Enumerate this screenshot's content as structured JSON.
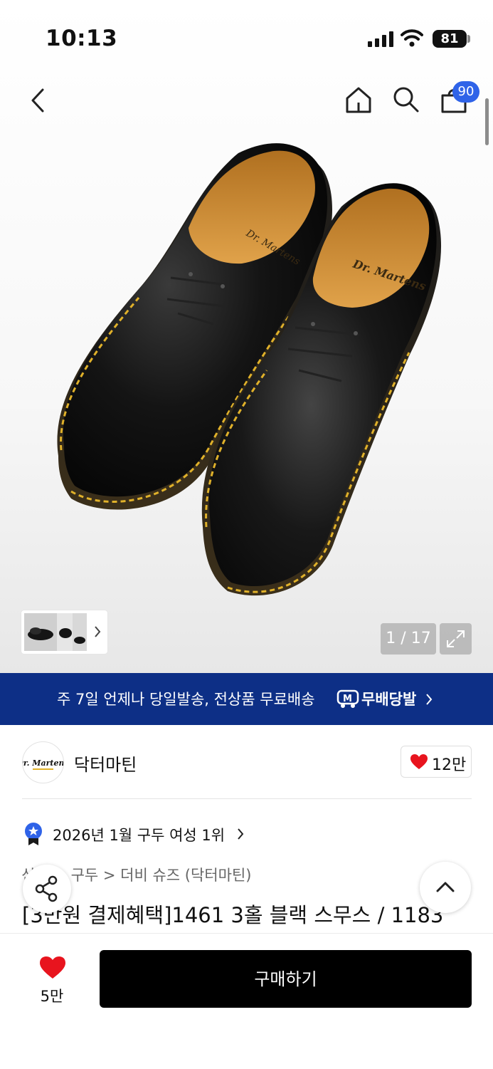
{
  "status_bar": {
    "time": "10:13",
    "battery": "81"
  },
  "header": {
    "cart_badge": "90",
    "icons": [
      "back-arrow-icon",
      "home-icon",
      "search-icon",
      "shopping-bag-icon"
    ]
  },
  "gallery": {
    "counter": "1 / 17",
    "expand_icon": "expand-icon"
  },
  "promo_banner": {
    "text": "주 7일 언제나 당일발송, 전상품 무료배송",
    "logo_text": "무배당발",
    "background": "#0d2f86"
  },
  "brand": {
    "name": "닥터마틴",
    "likes": "12만",
    "logo_text": "Dr. Martens"
  },
  "ranking": {
    "text": "2026년 1월 구두 여성 1위"
  },
  "breadcrumb": {
    "text": "신발 > 구두 > 더비 슈즈 (닥터마틴)"
  },
  "product": {
    "title": "[3만원 결제혜택]1461 3홀 블랙 스무스 / 1183"
  },
  "bottom_bar": {
    "wish_count": "5만",
    "buy_label": "구매하기"
  },
  "colors": {
    "accent_blue": "#2f63e8",
    "heart_red": "#e8141e",
    "dark": "#000000"
  }
}
